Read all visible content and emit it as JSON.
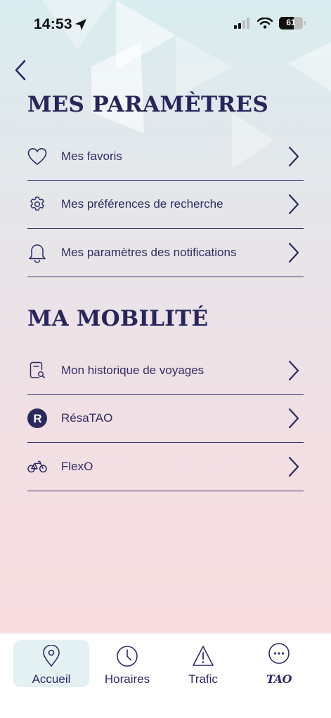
{
  "status_bar": {
    "time": "14:53",
    "battery": "61"
  },
  "sections": [
    {
      "title": "MES PARAMÈTRES",
      "items": [
        {
          "label": "Mes favoris",
          "icon": "heart-icon"
        },
        {
          "label": "Mes préférences de recherche",
          "icon": "gear-icon"
        },
        {
          "label": "Mes paramètres des notifications",
          "icon": "bell-icon"
        }
      ]
    },
    {
      "title": "MA MOBILITÉ",
      "items": [
        {
          "label": "Mon historique de voyages",
          "icon": "history-icon"
        },
        {
          "label": "RésaTAO",
          "icon": "resatao-icon"
        },
        {
          "label": "FlexO",
          "icon": "bike-icon"
        }
      ]
    }
  ],
  "tab_bar": {
    "tabs": [
      {
        "label": "Accueil",
        "icon": "location-pin-icon",
        "active": true
      },
      {
        "label": "Horaires",
        "icon": "clock-icon",
        "active": false
      },
      {
        "label": "Trafic",
        "icon": "warning-icon",
        "active": false
      },
      {
        "label": "TAO",
        "icon": "more-icon",
        "active": false
      }
    ]
  },
  "colors": {
    "primary": "#2b2860",
    "active_tab_bg": "#e3f1f3"
  }
}
